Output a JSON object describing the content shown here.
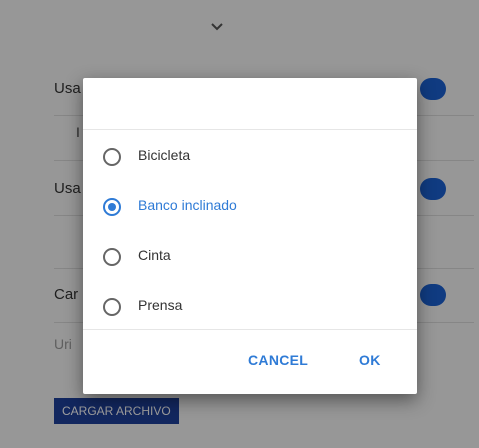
{
  "background": {
    "rows": [
      {
        "label": "Usa",
        "sub": "I"
      },
      {
        "label": "Usa",
        "sub": ""
      },
      {
        "label": "Car",
        "sub": ""
      }
    ],
    "placeholder": "Uri",
    "upload_button": "Cargar archivo"
  },
  "dialog": {
    "options": [
      {
        "label": "Bicicleta",
        "checked": false
      },
      {
        "label": "Banco inclinado",
        "checked": true
      },
      {
        "label": "Cinta",
        "checked": false
      },
      {
        "label": "Prensa",
        "checked": false
      }
    ],
    "cancel_label": "CANCEL",
    "ok_label": "OK"
  },
  "colors": {
    "accent": "#2f7bd6",
    "toggle": "#1a5fd0",
    "upload_button": "#1e3f9a"
  }
}
